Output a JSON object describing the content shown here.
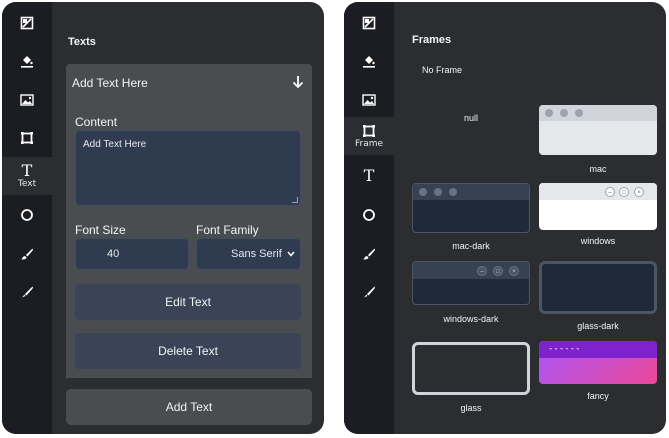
{
  "left": {
    "sidebar": [
      {
        "icon": "image-crop-icon",
        "label": ""
      },
      {
        "icon": "paint-bucket-icon",
        "label": ""
      },
      {
        "icon": "image-icon",
        "label": ""
      },
      {
        "icon": "frame-icon",
        "label": ""
      },
      {
        "icon": "text-icon",
        "label": "Text",
        "active": true
      },
      {
        "icon": "circle-icon",
        "label": ""
      },
      {
        "icon": "brush-icon",
        "label": ""
      },
      {
        "icon": "pen-icon",
        "label": ""
      }
    ],
    "title": "Texts",
    "card": {
      "header": "Add Text Here",
      "content_label": "Content",
      "content_value": "Add Text Here",
      "font_size_label": "Font Size",
      "font_size_value": "40",
      "font_family_label": "Font Family",
      "font_family_value": "Sans Serif",
      "edit_label": "Edit Text",
      "delete_label": "Delete Text"
    },
    "add_label": "Add Text"
  },
  "right": {
    "sidebar": [
      {
        "icon": "image-crop-icon",
        "label": ""
      },
      {
        "icon": "paint-bucket-icon",
        "label": ""
      },
      {
        "icon": "image-icon",
        "label": ""
      },
      {
        "icon": "frame-icon",
        "label": "Frame",
        "active": true
      },
      {
        "icon": "text-icon",
        "label": ""
      },
      {
        "icon": "circle-icon",
        "label": ""
      },
      {
        "icon": "brush-icon",
        "label": ""
      },
      {
        "icon": "pen-icon",
        "label": ""
      }
    ],
    "title": "Frames",
    "no_frame_label": "No Frame",
    "frames": [
      "null",
      "mac",
      "mac-dark",
      "windows",
      "windows-dark",
      "glass-dark",
      "glass",
      "fancy"
    ],
    "fancy_title_text": "------"
  },
  "colors": {
    "panel_bg": "#2b2d31",
    "iconbar_bg": "#1c1d22",
    "field_bg": "#2f3c50",
    "card_bg": "#4a4d4f",
    "fancy_gradient_start": "#7b2ff7",
    "fancy_gradient_end": "#e84393"
  }
}
